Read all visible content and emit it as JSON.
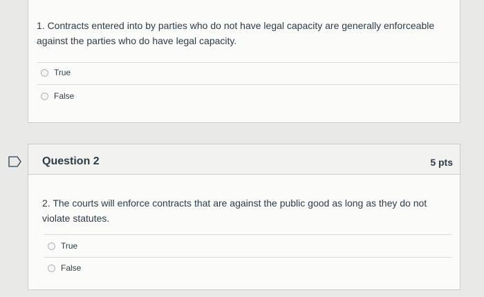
{
  "question1": {
    "text": "1. Contracts entered into by parties who do not have legal capacity are generally enforceable against the parties who do have legal capacity.",
    "answers": [
      {
        "label": "True"
      },
      {
        "label": "False"
      }
    ]
  },
  "question2": {
    "title": "Question 2",
    "points": "5 pts",
    "text": "2. The courts will enforce contracts that are against the public good as long as they do not violate statutes.",
    "answers": [
      {
        "label": "True"
      },
      {
        "label": "False"
      }
    ]
  },
  "icons": {
    "flag": "flag-question-icon"
  },
  "colors": {
    "text": "#2d3b45",
    "border": "#c9cccd",
    "background": "#e9e9e7"
  }
}
